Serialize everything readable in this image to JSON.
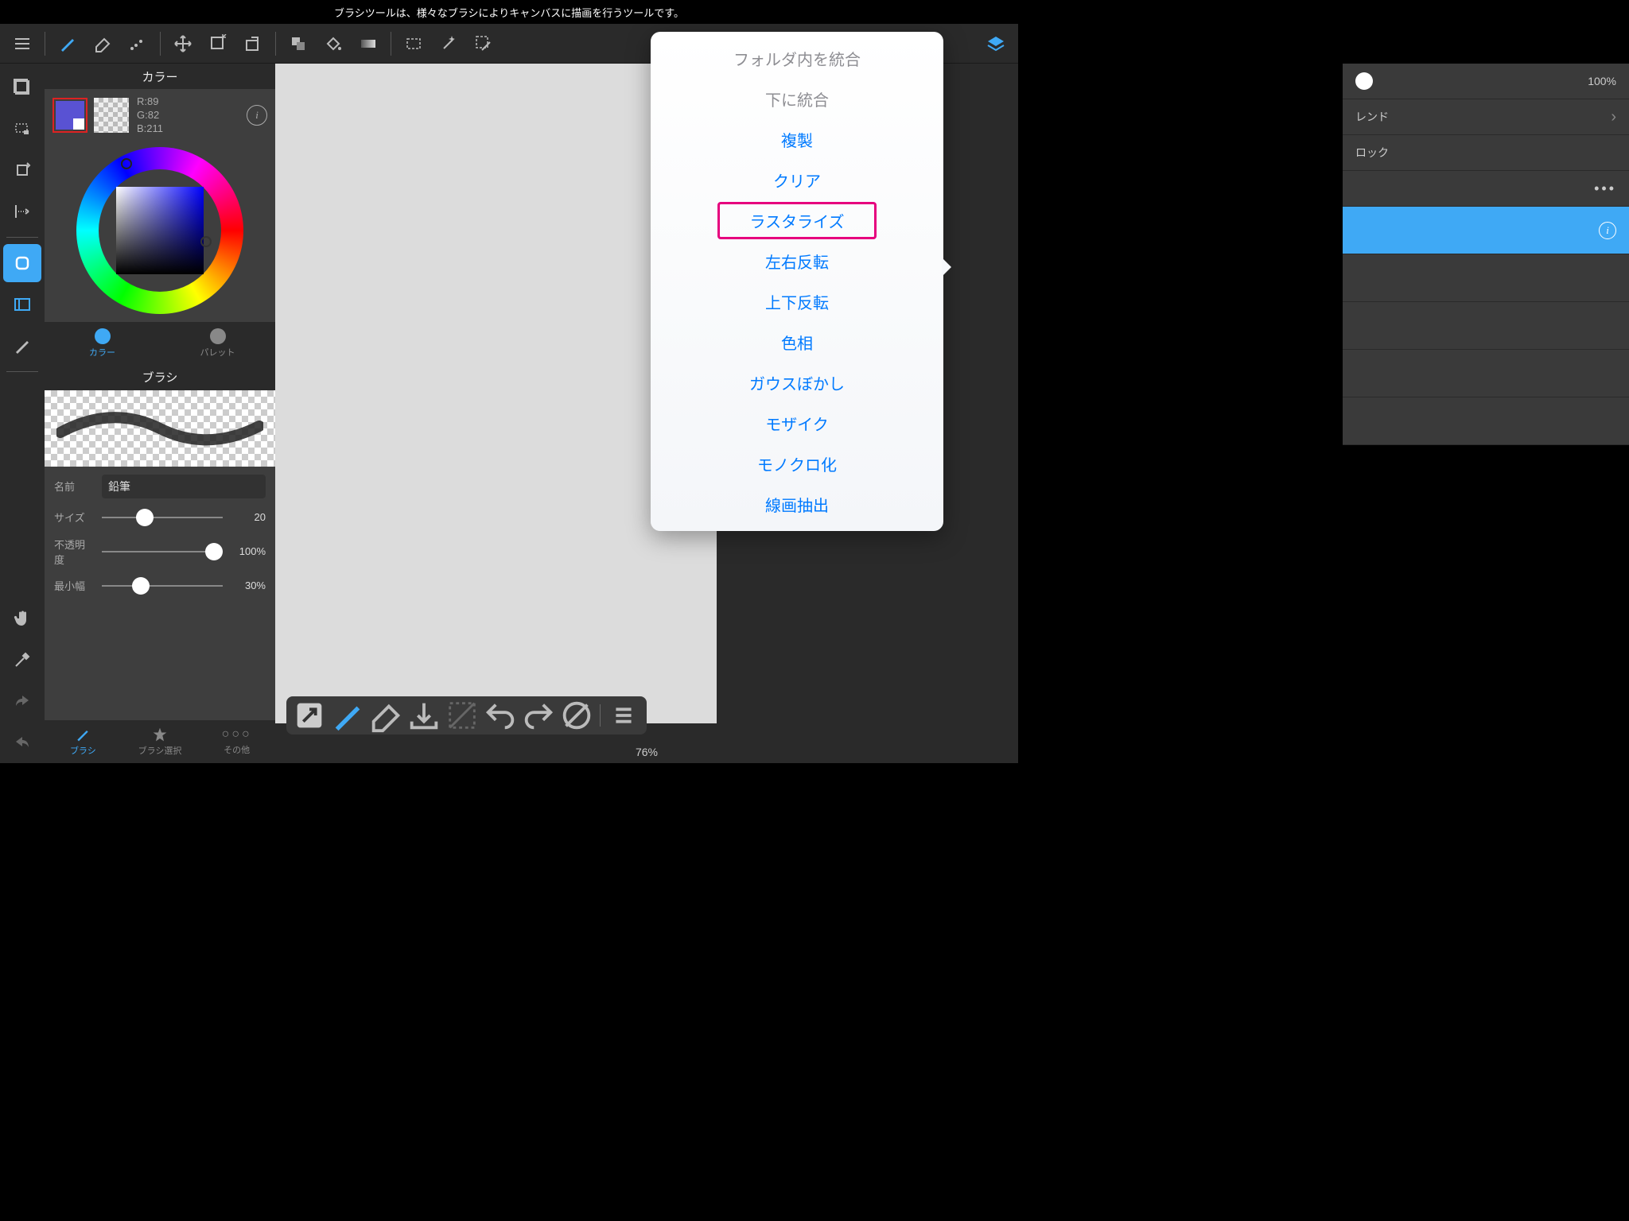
{
  "tooltip": "ブラシツールは、様々なブラシによりキャンバスに描画を行うツールです。",
  "color_panel": {
    "title": "カラー",
    "rgb_r": "R:89",
    "rgb_g": "G:82",
    "rgb_b": "B:211",
    "tab_color": "カラー",
    "tab_palette": "パレット"
  },
  "brush_panel": {
    "title": "ブラシ",
    "name_label": "名前",
    "name_value": "鉛筆",
    "size_label": "サイズ",
    "size_value": "20",
    "opacity_label": "不透明度",
    "opacity_value": "100%",
    "minwidth_label": "最小幅",
    "minwidth_value": "30%",
    "tab_brush": "ブラシ",
    "tab_select": "ブラシ選択",
    "tab_more": "その他"
  },
  "right_panel": {
    "opacity_value": "100%",
    "blend_label": "レンド",
    "lock_label": "ロック"
  },
  "zoom": "76%",
  "context_menu": {
    "items": [
      {
        "label": "フォルダ内を統合",
        "disabled": true
      },
      {
        "label": "下に統合",
        "disabled": true
      },
      {
        "label": "複製"
      },
      {
        "label": "クリア"
      },
      {
        "label": "ラスタライズ",
        "highlighted": true
      },
      {
        "label": "左右反転"
      },
      {
        "label": "上下反転"
      },
      {
        "label": "色相"
      },
      {
        "label": "ガウスぼかし"
      },
      {
        "label": "モザイク"
      },
      {
        "label": "モノクロ化"
      },
      {
        "label": "線画抽出"
      }
    ]
  }
}
